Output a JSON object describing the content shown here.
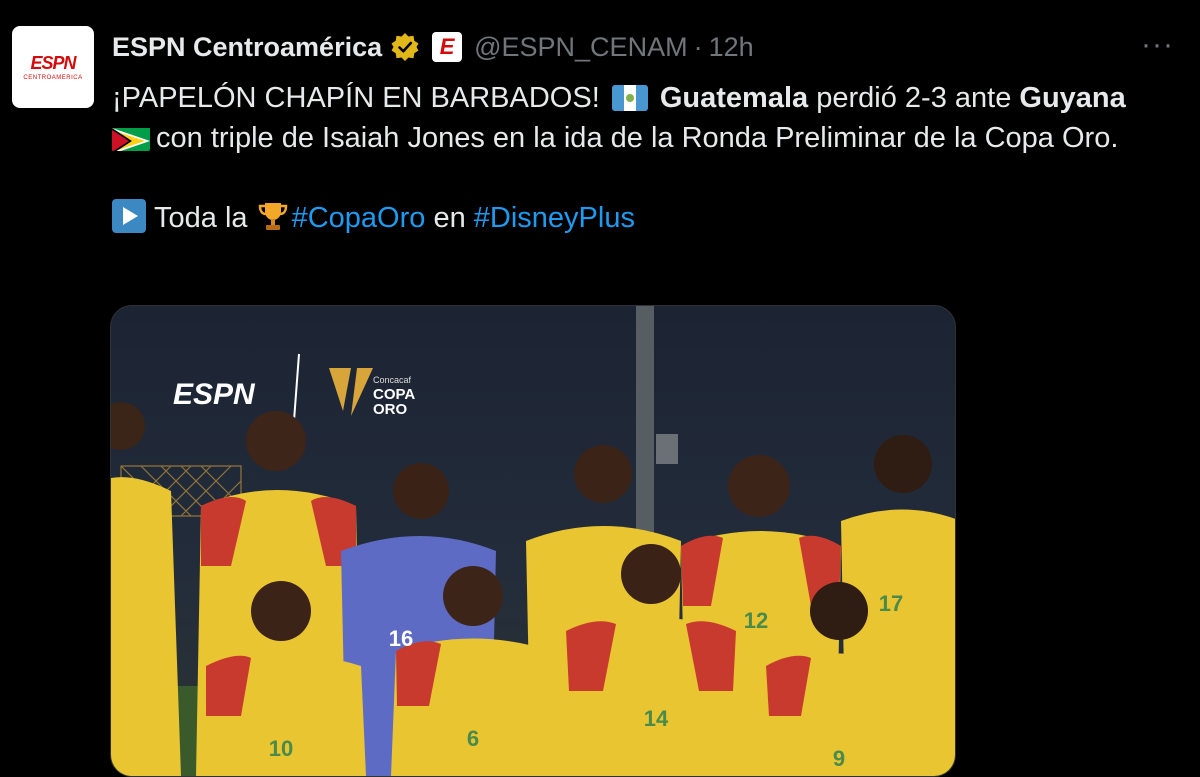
{
  "account": {
    "name": "ESPN Centroamérica",
    "handle": "@ESPN_CENAM",
    "separator": "·",
    "time": "12h",
    "avatar_logo": "ESPN",
    "avatar_sub": "CENTROAMERICA",
    "affiliate_badge": "E"
  },
  "menu": {
    "more_label": "···"
  },
  "tweet": {
    "line1_pre": "¡PAPELÓN CHAPÍN EN BARBADOS!",
    "team1": "Guatemala",
    "mid": "perdió 2-3 ante",
    "team2": "Guyana",
    "line2": "con triple de Isaiah Jones en la ida de la Ronda Preliminar de la Copa Oro.",
    "cta_pre": "Toda la",
    "hashtag1": "#CopaOro",
    "cta_mid": "en",
    "hashtag2": "#DisneyPlus"
  },
  "media": {
    "espn_logo": "ESPN",
    "cup_small": "Concacaf",
    "cup_big1": "COPA",
    "cup_big2": "ORO",
    "jersey_numbers": [
      "16",
      "17",
      "12",
      "10",
      "6",
      "14",
      "9"
    ]
  },
  "colors": {
    "background": "#000000",
    "text": "#e7e9ea",
    "muted": "#71767b",
    "link": "#1d9bf0",
    "verified_gold": "#e2b719",
    "espn_red": "#d50a0a",
    "jersey_yellow": "#e8c531",
    "jersey_red": "#c83a2e"
  },
  "icons": {
    "verified": "verified-gold-badge-icon",
    "more": "more-dots-icon",
    "guatemala_flag": "guatemala-flag-icon",
    "guyana_flag": "guyana-flag-icon",
    "play": "play-button-icon",
    "trophy": "trophy-icon"
  }
}
